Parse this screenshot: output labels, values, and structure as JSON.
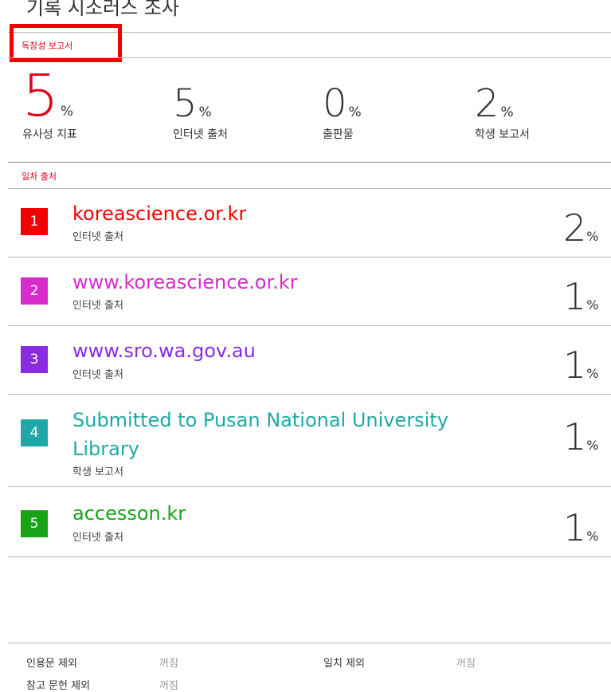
{
  "report": {
    "title": "기록 시소러스 조사",
    "section_label": "독창성 보고서"
  },
  "stats": [
    {
      "value": "5",
      "unit": "%",
      "caption": "유사성 지표"
    },
    {
      "value": "5",
      "unit": "%",
      "caption": "인터넷 출처"
    },
    {
      "value": "0",
      "unit": "%",
      "caption": "출판물"
    },
    {
      "value": "2",
      "unit": "%",
      "caption": "학생 보고서"
    }
  ],
  "sources_header": "일차 출처",
  "sources": [
    {
      "rank": "1",
      "name": "koreascience.or.kr",
      "type": "인터넷 출처",
      "percent": "2",
      "unit": "%",
      "color": "#f40000"
    },
    {
      "rank": "2",
      "name": "www.koreascience.or.kr",
      "type": "인터넷 출처",
      "percent": "1",
      "unit": "%",
      "color": "#d72ccb"
    },
    {
      "rank": "3",
      "name": "www.sro.wa.gov.au",
      "type": "인터넷 출처",
      "percent": "1",
      "unit": "%",
      "color": "#8a2be2"
    },
    {
      "rank": "4",
      "name_line1": "Submitted to Pusan National University",
      "name_line2": "Library",
      "type": "학생 보고서",
      "percent": "1",
      "unit": "%",
      "color": "#20a8a8"
    },
    {
      "rank": "5",
      "name": "accesson.kr",
      "type": "인터넷 출처",
      "percent": "1",
      "unit": "%",
      "color": "#17a317"
    }
  ],
  "footer": {
    "exclude_quotes_label": "인용문 제외",
    "exclude_quotes_value": "꺼짐",
    "exclude_matches_label": "일치 제외",
    "exclude_matches_value": "꺼짐",
    "exclude_bibliography_label": "참고 문헌 제외",
    "exclude_bibliography_value": "꺼짐"
  }
}
